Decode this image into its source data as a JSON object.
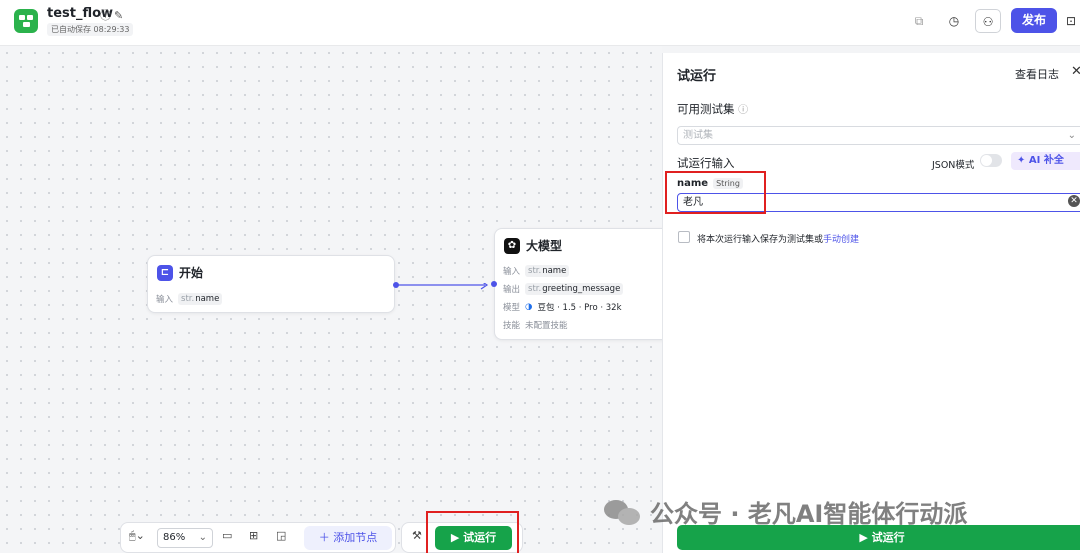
{
  "header": {
    "title": "test_flow",
    "autosave": "已自动保存 08:29:33",
    "publish_label": "发布"
  },
  "canvas": {
    "start_node": {
      "title": "开始",
      "input_label": "输入",
      "input_type": "str.",
      "input_name": "name"
    },
    "llm_node": {
      "title": "大模型",
      "input_label": "输入",
      "input_type": "str.",
      "input_name": "name",
      "output_label": "输出",
      "output_type": "str.",
      "output_name": "greeting_message",
      "model_label": "模型",
      "model_value": "豆包 · 1.5 · Pro · 32k",
      "skill_label": "技能",
      "skill_value": "未配置技能"
    }
  },
  "toolbar": {
    "zoom": "86%",
    "add_node_label": "添加节点",
    "test_run_label": "试运行"
  },
  "panel": {
    "title": "试运行",
    "view_log": "查看日志",
    "testset_label": "可用测试集",
    "testset_placeholder": "测试集",
    "input_label": "试运行输入",
    "json_mode_label": "JSON模式",
    "ai_complete_label": "AI 补全",
    "field_name": "name",
    "field_type": "String",
    "field_value": "老凡",
    "save_checkbox_text": "将本次运行输入保存为测试集或",
    "save_checkbox_link": "手动创建",
    "run_button_label": "试运行"
  },
  "watermark": {
    "text": "公众号 · 老凡AI智能体行动派"
  },
  "colors": {
    "brand": "#4d53e8",
    "run_green": "#16a34a",
    "highlight_red": "#e02020"
  }
}
